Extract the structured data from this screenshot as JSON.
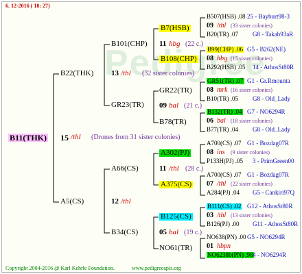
{
  "header": {
    "date": "6. 12-2016 ( 18: 27)"
  },
  "watermark": "Pedigree",
  "root": {
    "id": "B11(THK)",
    "bg": "#ffc0ff",
    "year": "15",
    "race": "/thl",
    "note": "(Drones from 31 sister colonies)"
  },
  "gen1": [
    {
      "id": "B22(THK)",
      "year": "13",
      "race": "/thl",
      "note": "(32 sister colonies)"
    },
    {
      "id": "A5(CS)",
      "year": "12",
      "race": "/thl",
      "note": ""
    }
  ],
  "gen2": [
    {
      "id": "B101(CHP)",
      "year": "",
      "race": "",
      "note": ""
    },
    {
      "id": "GR23(TR)",
      "year": "",
      "race": "",
      "note": ""
    },
    {
      "id": "A66(CS)",
      "year": "",
      "race": "",
      "note": ""
    },
    {
      "id": "B34(CS)",
      "year": "",
      "race": "",
      "note": ""
    }
  ],
  "gen3": [
    {
      "id": "B7(HSB)",
      "bg": "#ffff00",
      "year": "11",
      "race": "hbg",
      "note": "(22 c.)"
    },
    {
      "id": "B108(CHP)",
      "bg": "#ffff00",
      "year": "",
      "race": "",
      "note": ""
    },
    {
      "id": "GR22(TR)",
      "bg": "",
      "year": "09",
      "race": "bal",
      "note": "(21 c.)"
    },
    {
      "id": "B78(TR)",
      "bg": "",
      "year": "",
      "race": "",
      "note": ""
    },
    {
      "id": "A302(PJ)",
      "bg": "#00dd00",
      "year": "11",
      "race": "/thl",
      "note": "(28 c.)"
    },
    {
      "id": "A375(CS)",
      "bg": "#ffff00",
      "year": "",
      "race": "",
      "note": ""
    },
    {
      "id": "B125(CS)",
      "bg": "#00eeff",
      "year": "05",
      "race": "bal",
      "note": "(19 c.)"
    },
    {
      "id": "NO61(TR)",
      "bg": "",
      "year": "",
      "race": "",
      "note": ""
    }
  ],
  "gen4": [
    {
      "line1a": "B507(HSB) .08",
      "line1b": "25 - Bayburt98-3",
      "bg": "",
      "year": "09",
      "race": "/thl",
      "note": "(33 sister colonies)",
      "line3a": "B20(TR) .07",
      "line3b": "G8 - Takab93aR"
    },
    {
      "line1a": "B99(CHP) .06",
      "line1b": "G5 - B262(NE)",
      "bg": "#ffff00",
      "year": "08",
      "race": "hbg",
      "note": "(15 sister colonies)",
      "line3a": "B292(HSB) .05",
      "line3b": "14 - AthosSt80R"
    },
    {
      "line1a": "GR51(TR) .07",
      "line1b": "G1 - Gr.Rmounta",
      "bg": "#00dd00",
      "year": "08",
      "race": "mrk",
      "note": "(16 sister colonies)",
      "line3a": "B10(TR) .05",
      "line3b": "G8 - Old_Lady"
    },
    {
      "line1a": "B132(TR) .04",
      "line1b": "G7 - NO6294R",
      "bg": "#00dd00",
      "year": "06",
      "race": "bal",
      "note": "(18 sister colonies)",
      "line3a": "B77(TR) .04",
      "line3b": "G8 - Old_Lady"
    },
    {
      "line1a": "A700(CS) .07",
      "line1b": "G1 - Bozdag07R",
      "bg": "",
      "year": "08",
      "race": "ins",
      "note": "(9 sister colonies)",
      "line3a": "P133H(PJ) .05",
      "line3b": "3 - PrimGreen00"
    },
    {
      "line1a": "A700(CS) .07",
      "line1b": "G1 - Bozdag07R",
      "bg": "",
      "year": "07",
      "race": "/thl",
      "note": "(22 sister colonies)",
      "line3a": "A284(PJ) .04",
      "line3b": "G5 - Cankiri97Q"
    },
    {
      "line1a": "B111(CS) .02",
      "line1b": "G12 - AthosSt80R",
      "bg": "#00eeff",
      "year": "03",
      "race": "/thl",
      "note": "(13 sister colonies)",
      "line3a": "B126(PJ) .00",
      "line3b": "G11 - AthosSt80R"
    },
    {
      "line1a": "NO638(PN) .00",
      "line1b": "G5 - NO6294R",
      "bg": "",
      "year": "01",
      "race": "hbpn",
      "note": "",
      "line3a": "NO6238b(PN) .98",
      "line3b": "4 - NO6294R",
      "line3bg": "#00dd00"
    }
  ],
  "footer": {
    "copyright": "Copyright 2004-2016 @ Karl Kehrle Foundation.",
    "url": "www.pedigreeapis.org"
  }
}
